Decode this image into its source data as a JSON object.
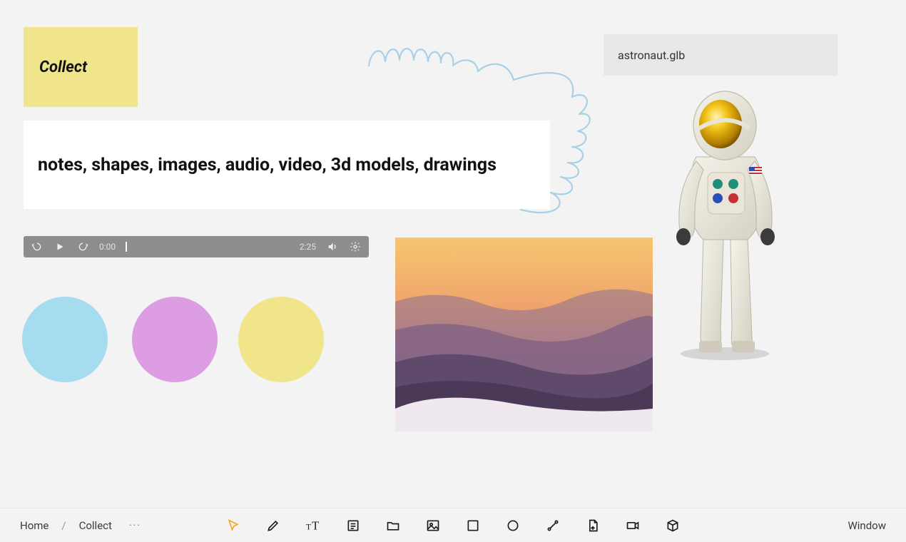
{
  "sticky": {
    "title": "Collect"
  },
  "textcard": {
    "text": "notes, shapes, images, audio, video, 3d models, drawings"
  },
  "file": {
    "name": "astronaut.glb"
  },
  "audio": {
    "rewind_amount": "15",
    "forward_amount": "15",
    "current_time": "0:00",
    "duration": "2:25"
  },
  "shapes": {
    "circle1_color": "#a6dcef",
    "circle2_color": "#dd9de2",
    "circle3_color": "#f0e58a"
  },
  "breadcrumbs": {
    "home": "Home",
    "sep": "/",
    "current": "Collect",
    "more": "···"
  },
  "toolbar": {
    "cursor": "cursor-tool",
    "draw": "draw-tool",
    "text": "text-tool",
    "note": "note-tool",
    "folder": "folder-tool",
    "image": "image-tool",
    "rect": "rect-tool",
    "circle": "circle-tool",
    "connector": "connector-tool",
    "file": "file-tool",
    "video": "video-tool",
    "model3d": "model3d-tool"
  },
  "right_menu": {
    "window": "Window"
  }
}
